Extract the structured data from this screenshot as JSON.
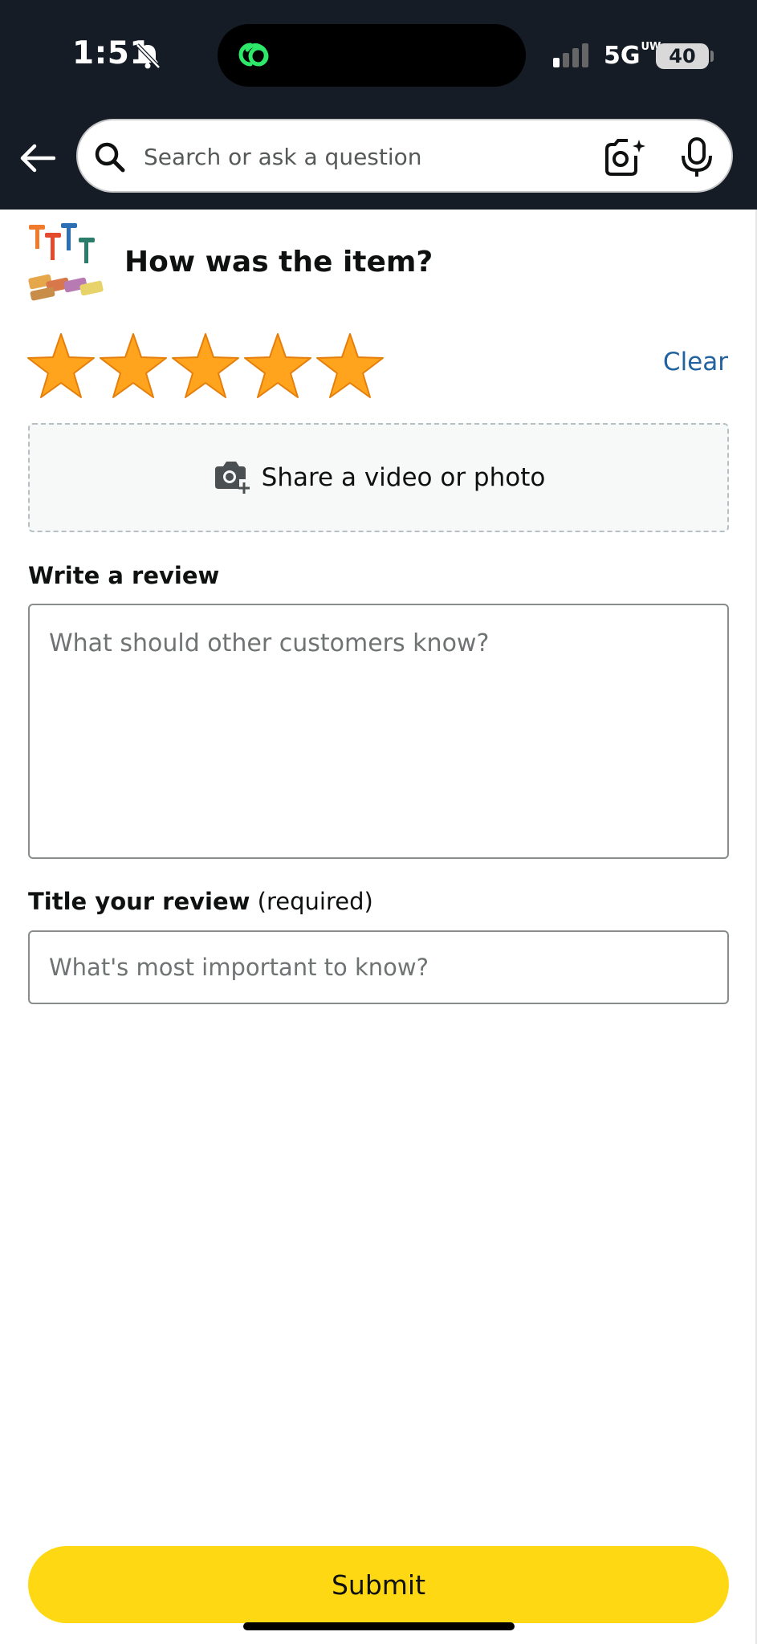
{
  "status_bar": {
    "time": "1:51",
    "network": "5G",
    "network_sup": "UW",
    "battery": "40"
  },
  "header": {
    "search_placeholder": "Search or ask a question"
  },
  "review": {
    "question": "How was the item?",
    "rating": 5,
    "clear_label": "Clear",
    "upload_label": "Share a video or photo",
    "write_label": "Write a review",
    "write_placeholder": "What should other customers know?",
    "title_label": "Title your review",
    "title_required": "(required)",
    "title_placeholder": "What's most important to know?",
    "submit_label": "Submit"
  },
  "colors": {
    "header_bg": "#151c26",
    "star": "#ffa41c",
    "link": "#2162a1",
    "submit_bg": "#ffd814"
  }
}
